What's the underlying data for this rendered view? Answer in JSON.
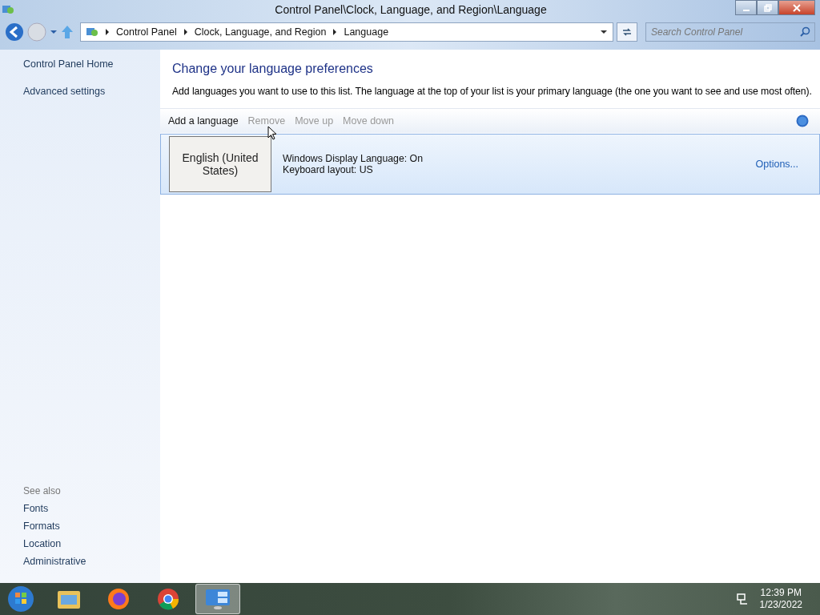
{
  "window": {
    "title": "Control Panel\\Clock, Language, and Region\\Language"
  },
  "address": {
    "breadcrumb": [
      "Control Panel",
      "Clock, Language, and Region",
      "Language"
    ]
  },
  "search": {
    "placeholder": "Search Control Panel"
  },
  "sidebar": {
    "items": [
      "Control Panel Home",
      "Advanced settings"
    ],
    "see_also": {
      "heading": "See also",
      "links": [
        "Fonts",
        "Formats",
        "Location",
        "Administrative"
      ]
    }
  },
  "main": {
    "heading": "Change your language preferences",
    "description": "Add languages you want to use to this list. The language at the top of your list is your primary language (the one you want to see and use most often).",
    "toolbar": [
      {
        "label": "Add a language",
        "disabled": false
      },
      {
        "label": "Remove",
        "disabled": true
      },
      {
        "label": "Move up",
        "disabled": true
      },
      {
        "label": "Move down",
        "disabled": true
      }
    ],
    "languages": [
      {
        "name": "English (United States)",
        "details": [
          "Windows Display Language: On",
          "Keyboard layout: US"
        ],
        "options": "Options...",
        "selected": true
      }
    ]
  },
  "taskbar": {
    "apps": [
      {
        "kind": "explorer",
        "selected": false
      },
      {
        "kind": "firefox",
        "selected": false
      },
      {
        "kind": "chrome",
        "selected": false
      },
      {
        "kind": "control-panel",
        "selected": true
      }
    ],
    "time": "12:39 PM",
    "date": "1/23/2022"
  }
}
